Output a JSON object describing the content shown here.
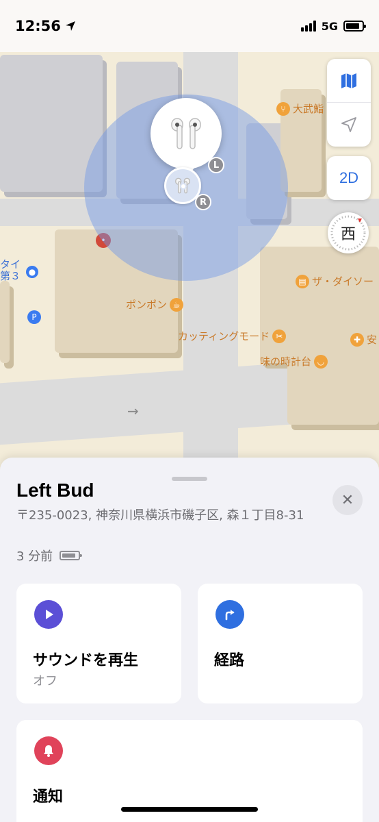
{
  "status_bar": {
    "time": "12:56",
    "network": "5G",
    "battery_level": 0.85
  },
  "map": {
    "pois": [
      {
        "label": "大武鮨",
        "icon": "fork-knife-icon"
      },
      {
        "label": "ザ・ダイソー",
        "icon": "shopping-bag-icon"
      },
      {
        "label": "ポンポン",
        "icon": "coffee-cup-icon"
      },
      {
        "label": "カッティングモード",
        "icon": "scissors-icon"
      },
      {
        "label": "味の時計台",
        "icon": "bowl-icon"
      },
      {
        "label": "安",
        "icon": "pharmacy-icon"
      },
      {
        "label": "タイ",
        "icon": ""
      },
      {
        "label": "第３",
        "icon": ""
      }
    ],
    "parking_label": "P",
    "controls": {
      "mode_2d_label": "2D",
      "compass_label": "西"
    },
    "pins": {
      "left_badge": "L",
      "right_badge": "R"
    }
  },
  "sheet": {
    "title": "Left Bud",
    "address": "〒235-0023, 神奈川県横浜市磯子区, 森１丁目8-31",
    "time_ago": "3 分前",
    "battery_level": 0.85,
    "close_icon": "close-icon",
    "actions": [
      {
        "label": "サウンドを再生",
        "sub": "オフ",
        "icon": "play-icon",
        "color": "#5b4fd6"
      },
      {
        "label": "経路",
        "sub": "",
        "icon": "directions-arrow-icon",
        "color": "#2f6fe0"
      },
      {
        "label": "通知",
        "sub": "",
        "icon": "bell-icon",
        "color": "#e0435a"
      }
    ]
  }
}
